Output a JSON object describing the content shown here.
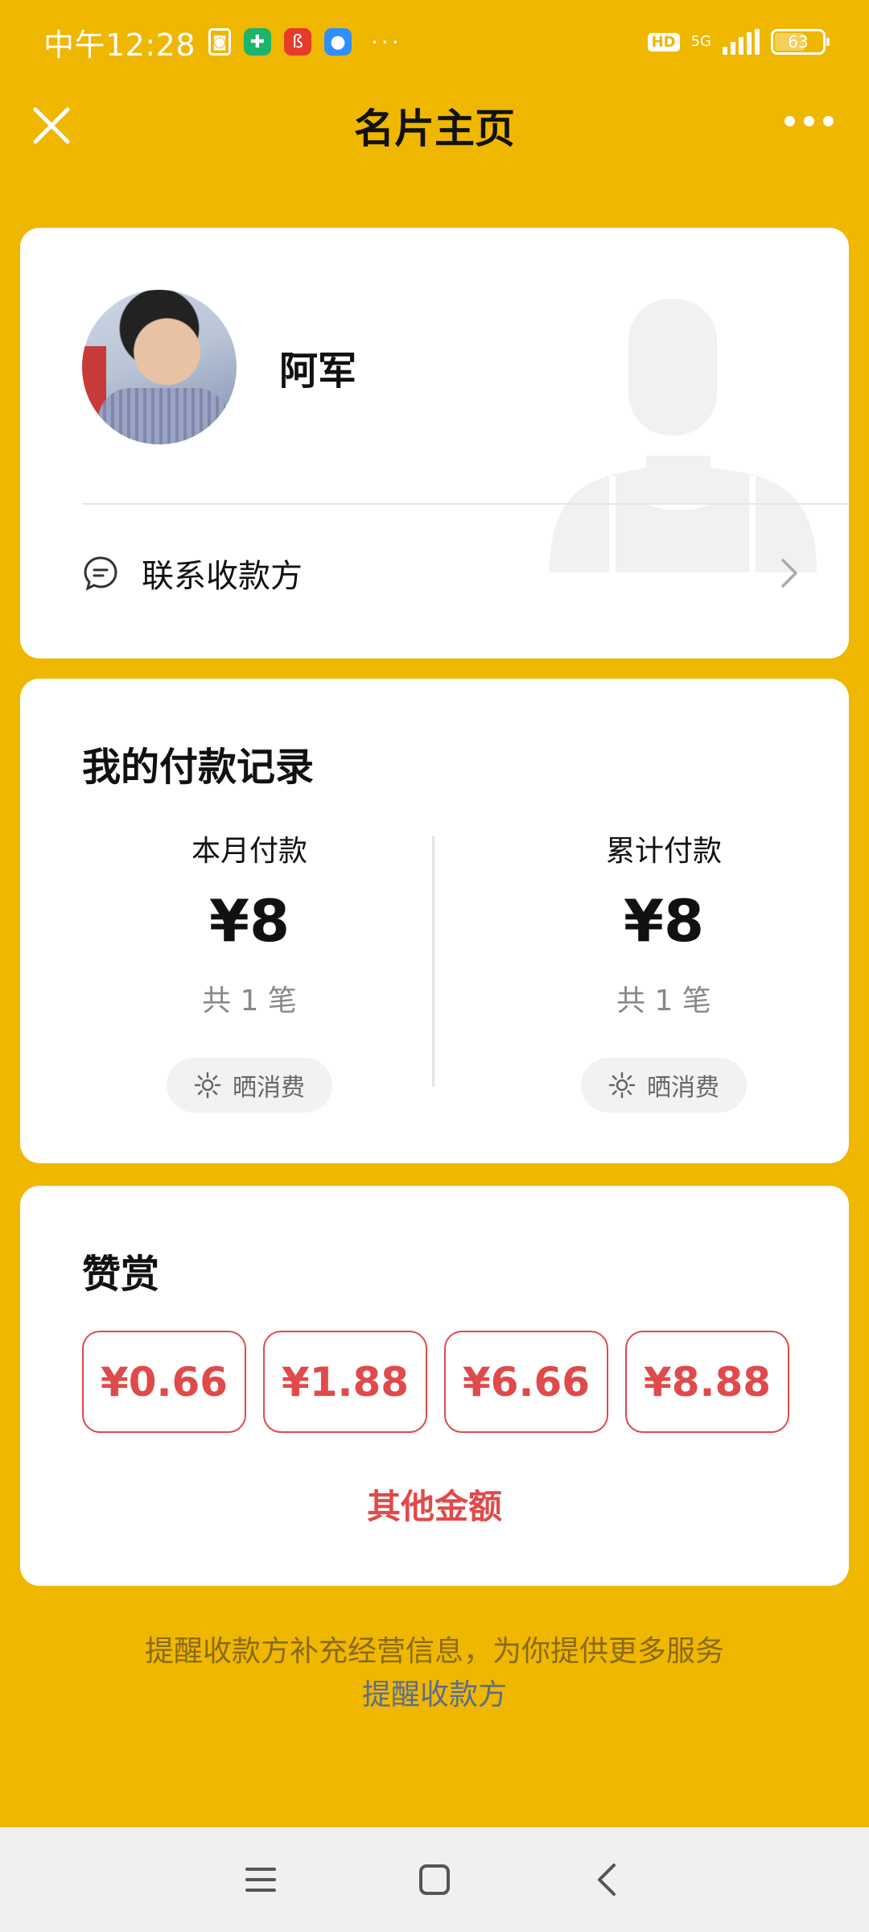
{
  "status_bar": {
    "time": "中午12:28",
    "dots": "···",
    "hd": "HD",
    "network": "5G",
    "battery": "63"
  },
  "nav": {
    "title": "名片主页"
  },
  "profile": {
    "name": "阿军",
    "contact_label": "联系收款方"
  },
  "payments": {
    "title": "我的付款记录",
    "columns": [
      {
        "label": "本月付款",
        "amount": "¥8",
        "count": "共 1 笔",
        "share_label": "晒消费"
      },
      {
        "label": "累计付款",
        "amount": "¥8",
        "count": "共 1 笔",
        "share_label": "晒消费"
      }
    ]
  },
  "tip": {
    "title": "赞赏",
    "options": [
      "¥0.66",
      "¥1.88",
      "¥6.66",
      "¥8.88"
    ],
    "other_label": "其他金额"
  },
  "footer": {
    "note": "提醒收款方补充经营信息，为你提供更多服务",
    "link": "提醒收款方"
  },
  "colors": {
    "background": "#EFB700",
    "accent_red": "#E04A4A",
    "link_blue": "#5b6d8c"
  }
}
